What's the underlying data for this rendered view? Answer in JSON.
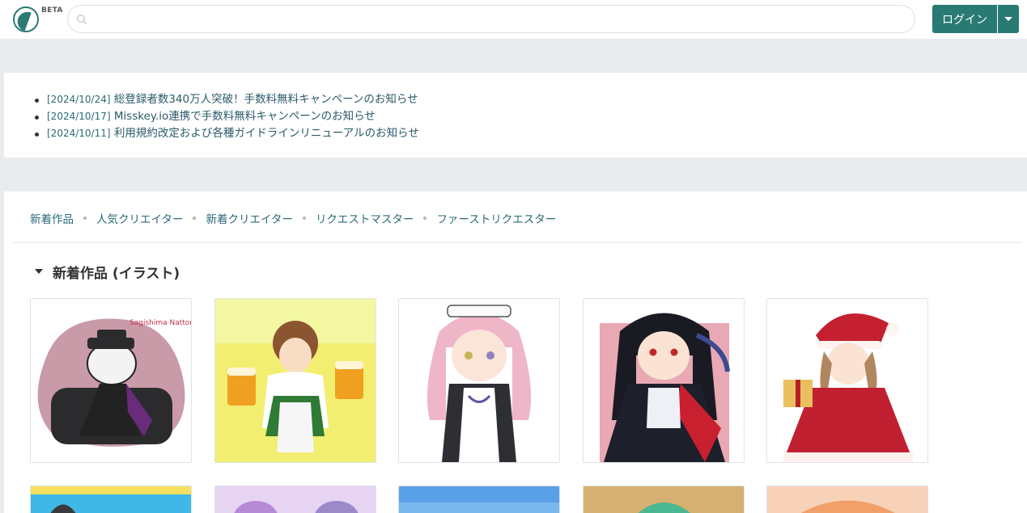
{
  "header": {
    "beta": "BETA",
    "search_placeholder": "",
    "login_label": "ログイン",
    "accent_color": "#2a7a74"
  },
  "news": [
    {
      "date": "[2024/10/24]",
      "text": " 総登録者数340万人突破！手数料無料キャンペーンのお知らせ"
    },
    {
      "date": "[2024/10/17]",
      "text": " Misskey.io連携で手数料無料キャンペーンのお知らせ"
    },
    {
      "date": "[2024/10/11]",
      "text": " 利用規約改定および各種ガイドラインリニューアルのお知らせ"
    }
  ],
  "subnav": [
    "新着作品",
    "人気クリエイター",
    "新着クリエイター",
    "リクエストマスター",
    "ファーストリクエスター"
  ],
  "section": {
    "title": "新着作品 (イラスト)"
  },
  "artworks": [
    {
      "icon": "artwork-thumbnail",
      "caption": "Sagishima Nattoriさんへ"
    },
    {
      "icon": "artwork-thumbnail"
    },
    {
      "icon": "artwork-thumbnail"
    },
    {
      "icon": "artwork-thumbnail"
    },
    {
      "icon": "artwork-thumbnail"
    }
  ]
}
